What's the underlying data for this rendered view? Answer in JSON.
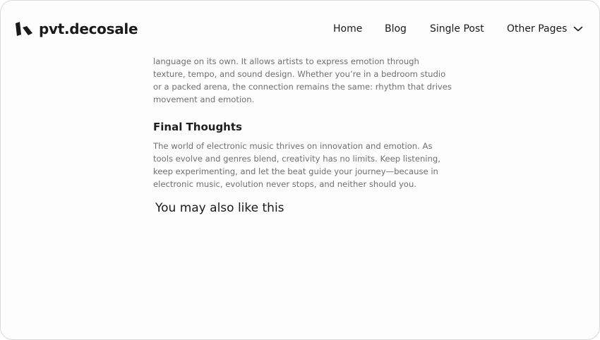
{
  "site": {
    "logo_text": "pvt.decosale"
  },
  "nav": {
    "items": [
      {
        "label": "Home"
      },
      {
        "label": "Blog"
      },
      {
        "label": "Single Post"
      },
      {
        "label": "Other Pages"
      }
    ]
  },
  "article": {
    "intro_lines": [
      "language on its own. It allows artists to express emotion through",
      "texture, tempo, and sound design. Whether you’re in a bedroom studio",
      "or a packed arena, the connection remains the same: rhythm that drives",
      "movement and emotion."
    ],
    "section_title": "Final Thoughts",
    "section_lines": [
      "The world of electronic music thrives on innovation and emotion. As",
      "tools evolve and genres blend, creativity has no limits. Keep listening,",
      "keep experimenting, and let the beat guide your journey—because in",
      "electronic music, evolution never stops, and neither should you."
    ]
  },
  "related": {
    "title": "You may also like this"
  }
}
